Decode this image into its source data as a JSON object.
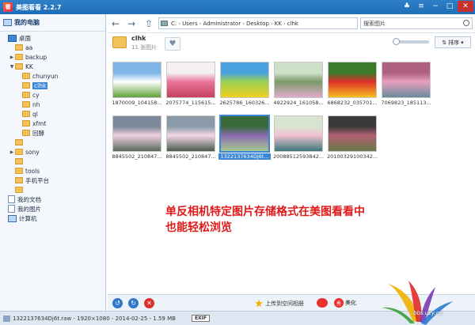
{
  "app": {
    "title": "美图看看 2.2.7",
    "logo_char": "看"
  },
  "sidebar": {
    "header": "我的电脑",
    "tree": [
      {
        "label": "桌面",
        "indent": 0,
        "icon": "desktop"
      },
      {
        "label": "aa",
        "indent": 1,
        "icon": "folder"
      },
      {
        "label": "backup",
        "indent": 1,
        "icon": "folder",
        "arrow": "▶"
      },
      {
        "label": "KK",
        "indent": 1,
        "icon": "folder",
        "arrow": "▼"
      },
      {
        "label": "chunyun",
        "indent": 2,
        "icon": "folder"
      },
      {
        "label": "clhk",
        "indent": 2,
        "icon": "folder",
        "selected": true
      },
      {
        "label": "cy",
        "indent": 2,
        "icon": "folder"
      },
      {
        "label": "nh",
        "indent": 2,
        "icon": "folder"
      },
      {
        "label": "ql",
        "indent": 2,
        "icon": "folder"
      },
      {
        "label": "xfmt",
        "indent": 2,
        "icon": "folder"
      },
      {
        "label": "回酵",
        "indent": 2,
        "icon": "folder"
      },
      {
        "label": "",
        "indent": 1,
        "icon": "folder"
      },
      {
        "label": "sony",
        "indent": 1,
        "icon": "folder",
        "arrow": "▶"
      },
      {
        "label": "",
        "indent": 1,
        "icon": "folder"
      },
      {
        "label": "tools",
        "indent": 1,
        "icon": "folder"
      },
      {
        "label": "手机平台",
        "indent": 1,
        "icon": "folder"
      },
      {
        "label": "",
        "indent": 1,
        "icon": "folder"
      },
      {
        "label": "我的文档",
        "indent": 0,
        "icon": "doc"
      },
      {
        "label": "我的图片",
        "indent": 0,
        "icon": "doc"
      },
      {
        "label": "计算机",
        "indent": 0,
        "icon": "pc"
      }
    ]
  },
  "nav": {
    "path": [
      "C:",
      "Users",
      "Administrator",
      "Desktop",
      "KK",
      "clhk"
    ],
    "search_placeholder": "搜索图片"
  },
  "folder": {
    "name": "clhk",
    "count": "11 张图片",
    "sort_label": "排序"
  },
  "thumbnails": [
    {
      "caption": "1870009_104158...",
      "palette": [
        "#7fb6e8",
        "#ffffff",
        "#5fa33a"
      ]
    },
    {
      "caption": "2075774_115615...",
      "palette": [
        "#f4f0f2",
        "#e8769c",
        "#c8405e"
      ]
    },
    {
      "caption": "2625786_160326...",
      "palette": [
        "#4aa3e0",
        "#9ad050",
        "#f0d020"
      ]
    },
    {
      "caption": "4922924_161058...",
      "palette": [
        "#cfe0c8",
        "#7a9a6a",
        "#e0aac8"
      ]
    },
    {
      "caption": "6868232_035701...",
      "palette": [
        "#3a7a2a",
        "#e0302a",
        "#f4c020"
      ]
    },
    {
      "caption": "7069823_185113...",
      "palette": [
        "#b06080",
        "#e8a0c0",
        "#6a8a9a"
      ]
    },
    {
      "caption": "8845502_210847...",
      "palette": [
        "#7a8a9a",
        "#f0d0e0",
        "#5a6a5a"
      ]
    },
    {
      "caption": "8845502_210847...",
      "palette": [
        "#8a9aa8",
        "#f4d8e6",
        "#4a5a4a"
      ]
    },
    {
      "caption": "1322137634Dj6t...",
      "palette": [
        "#3a6a3a",
        "#8a6ab0",
        "#a8c890"
      ],
      "selected": true
    },
    {
      "caption": "20088512593842...",
      "palette": [
        "#d8e4d0",
        "#f0c0d0",
        "#3a7a7a"
      ]
    },
    {
      "caption": "20100329100342...",
      "palette": [
        "#3a3a3a",
        "#b06070",
        "#6a7a4a"
      ]
    }
  ],
  "overlay": {
    "line1": "单反相机特定图片存储格式在美图看看中",
    "line2": "也能轻松浏览"
  },
  "bottom": {
    "upload_label": "上传到空间相册",
    "beautify_label": "美化",
    "beautify_icon": "秀"
  },
  "status": {
    "text": "1322137634Dj6t.raw - 1920×1080 - 2014-02-25 - 1.59 MB",
    "exif": "EXIF"
  },
  "watermark": {
    "text": "bbs.uzy.cn"
  }
}
